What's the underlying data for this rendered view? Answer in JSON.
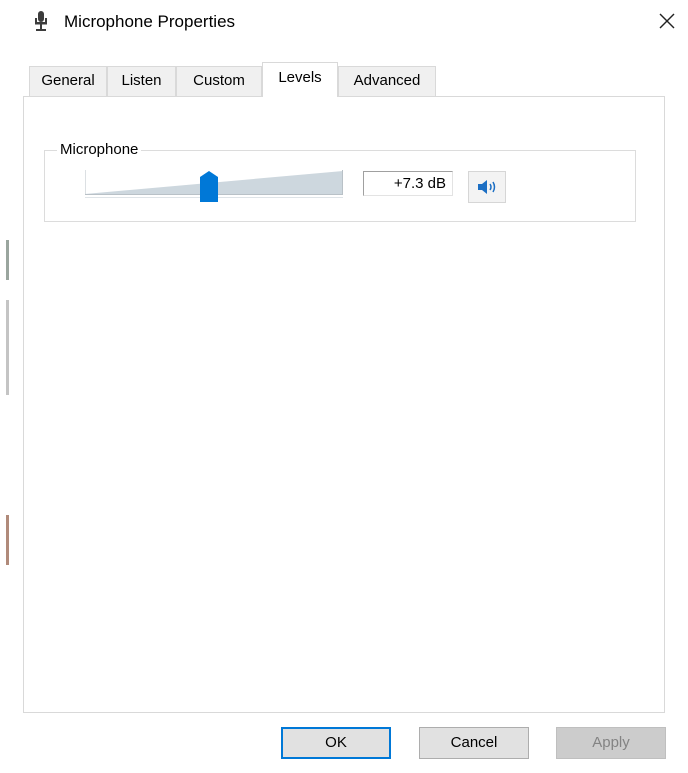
{
  "window": {
    "title": "Microphone Properties",
    "title_icon": "microphone-icon",
    "close_icon": "close-icon"
  },
  "tabs": [
    {
      "label": "General",
      "active": false
    },
    {
      "label": "Listen",
      "active": false
    },
    {
      "label": "Custom",
      "active": false
    },
    {
      "label": "Levels",
      "active": true
    },
    {
      "label": "Advanced",
      "active": false
    }
  ],
  "levels": {
    "group_label": "Microphone",
    "slider_level_fraction": 0.48,
    "db_value": "+7.3 dB",
    "mute_icon": "speaker-icon"
  },
  "buttons": {
    "ok": "OK",
    "cancel": "Cancel",
    "apply": "Apply"
  },
  "colors": {
    "accent": "#0078d7",
    "track_fill": "#cdd7de",
    "track_lines": "#b9c1c7"
  }
}
